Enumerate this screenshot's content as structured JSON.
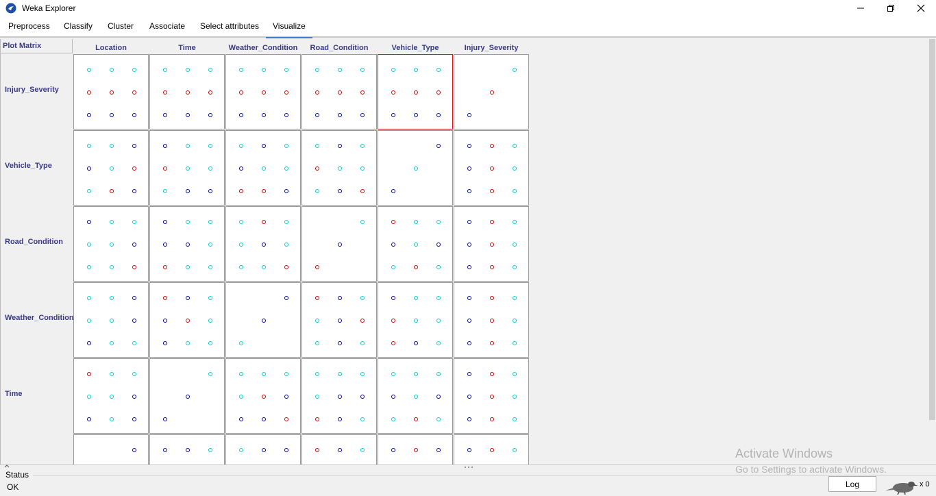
{
  "window": {
    "title": "Weka Explorer"
  },
  "tabs": [
    {
      "label": "Preprocess"
    },
    {
      "label": "Classify"
    },
    {
      "label": "Cluster"
    },
    {
      "label": "Associate"
    },
    {
      "label": "Select attributes"
    },
    {
      "label": "Visualize"
    }
  ],
  "matrix": {
    "label": "Plot Matrix",
    "columns": [
      "Location",
      "Time",
      "Weather_Condition",
      "Road_Condition",
      "Vehicle_Type",
      "Injury_Severity"
    ],
    "rows": [
      "Injury_Severity",
      "Vehicle_Type",
      "Road_Condition",
      "Weather_Condition",
      "Time"
    ],
    "colors": {
      "c": "#00d2d2",
      "r": "#d40000",
      "b": "#0000a0"
    },
    "cells": [
      [
        [
          "c",
          "c",
          "c",
          "r",
          "r",
          "r",
          "b",
          "b",
          "b"
        ],
        [
          "c",
          "c",
          "c",
          "r",
          "r",
          "r",
          "b",
          "b",
          "b"
        ],
        [
          "c",
          "c",
          "c",
          "r",
          "r",
          "r",
          "b",
          "b",
          "b"
        ],
        [
          "c",
          "c",
          "c",
          "r",
          "r",
          "r",
          "b",
          "b",
          "b"
        ],
        [
          "c",
          "c",
          "c",
          "r",
          "r",
          "r",
          "b",
          "b",
          "b"
        ],
        [
          "",
          "",
          "c",
          "",
          "r",
          "",
          "b",
          "",
          ""
        ]
      ],
      [
        [
          "c",
          "c",
          "b",
          "b",
          "c",
          "r",
          "c",
          "r",
          "b"
        ],
        [
          "b",
          "c",
          "c",
          "r",
          "c",
          "c",
          "c",
          "b",
          "b"
        ],
        [
          "c",
          "b",
          "c",
          "b",
          "c",
          "c",
          "r",
          "r",
          "b"
        ],
        [
          "c",
          "b",
          "c",
          "r",
          "c",
          "c",
          "c",
          "b",
          "r"
        ],
        [
          "",
          "",
          "b",
          "",
          "c",
          "",
          "b",
          "",
          ""
        ],
        [
          "b",
          "r",
          "c",
          "b",
          "r",
          "c",
          "b",
          "r",
          "c"
        ]
      ],
      [
        [
          "b",
          "c",
          "c",
          "c",
          "c",
          "b",
          "c",
          "c",
          "r"
        ],
        [
          "b",
          "c",
          "c",
          "b",
          "b",
          "c",
          "r",
          "c",
          "c"
        ],
        [
          "c",
          "r",
          "c",
          "c",
          "b",
          "c",
          "c",
          "c",
          "r"
        ],
        [
          "",
          "",
          "c",
          "",
          "b",
          "",
          "r",
          "",
          ""
        ],
        [
          "r",
          "c",
          "c",
          "b",
          "c",
          "b",
          "c",
          "r",
          "c"
        ],
        [
          "b",
          "r",
          "c",
          "b",
          "r",
          "c",
          "b",
          "r",
          "c"
        ]
      ],
      [
        [
          "c",
          "c",
          "b",
          "c",
          "c",
          "b",
          "b",
          "c",
          "c"
        ],
        [
          "r",
          "b",
          "c",
          "b",
          "r",
          "c",
          "b",
          "c",
          "c"
        ],
        [
          "",
          "",
          "b",
          "",
          "b",
          "",
          "c",
          "",
          ""
        ],
        [
          "r",
          "b",
          "c",
          "c",
          "b",
          "r",
          "c",
          "b",
          "c"
        ],
        [
          "b",
          "c",
          "c",
          "r",
          "c",
          "c",
          "r",
          "b",
          "c"
        ],
        [
          "b",
          "r",
          "c",
          "b",
          "r",
          "c",
          "b",
          "r",
          "c"
        ]
      ],
      [
        [
          "r",
          "c",
          "c",
          "c",
          "c",
          "b",
          "b",
          "c",
          "b"
        ],
        [
          "",
          "",
          "c",
          "",
          "b",
          "",
          "b",
          "",
          ""
        ],
        [
          "c",
          "c",
          "c",
          "c",
          "r",
          "b",
          "b",
          "b",
          "r"
        ],
        [
          "c",
          "c",
          "c",
          "c",
          "b",
          "b",
          "r",
          "b",
          "c"
        ],
        [
          "c",
          "c",
          "c",
          "b",
          "c",
          "b",
          "c",
          "r",
          "c"
        ],
        [
          "b",
          "r",
          "c",
          "b",
          "r",
          "c",
          "b",
          "r",
          "c"
        ]
      ],
      [
        [
          "",
          "",
          "b"
        ],
        [
          "b",
          "b",
          "c"
        ],
        [
          "c",
          "b",
          "b"
        ],
        [
          "r",
          "b",
          "c"
        ],
        [
          "b",
          "r",
          "b"
        ],
        [
          "b",
          "r",
          "c"
        ]
      ]
    ],
    "selected": {
      "row": 0,
      "col": 4
    }
  },
  "status": {
    "title": "Status",
    "text": "OK"
  },
  "log_button": {
    "label": "Log"
  },
  "tasks": {
    "count": "x 0"
  },
  "watermark": {
    "line1": "Activate Windows",
    "line2": "Go to Settings to activate Windows."
  }
}
